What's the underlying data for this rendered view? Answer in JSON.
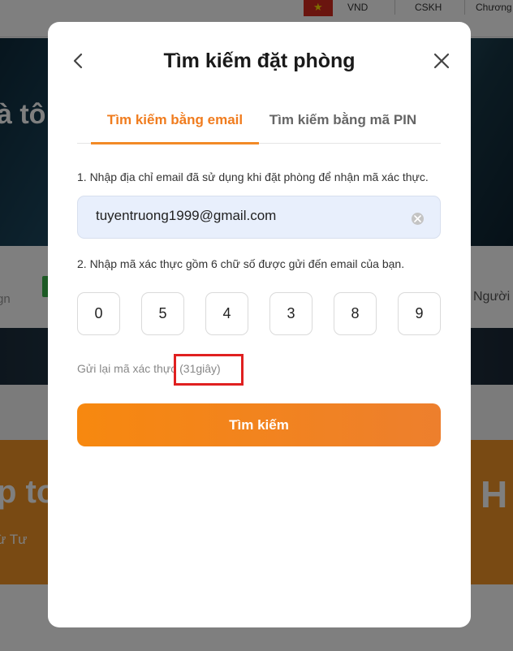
{
  "background": {
    "currency": "VND",
    "support": "CSKH",
    "promo": "Chương",
    "hero_text": "à tô",
    "left_text": "gn",
    "right_text": "Người",
    "banner_big": "p to",
    "banner_small": "ừ Tư",
    "banner_right": "H"
  },
  "modal": {
    "title": "Tìm kiếm đặt phòng",
    "tabs": [
      {
        "label": "Tìm kiếm bằng email"
      },
      {
        "label": "Tìm kiếm bằng mã PIN"
      }
    ],
    "step1_label": "1. Nhập địa chỉ email đã sử dụng khi đặt phòng để nhận mã xác thực.",
    "email_value": "tuyentruong1999@gmail.com",
    "step2_label": "2. Nhập mã xác thực gồm 6 chữ số được gửi đến email của bạn.",
    "code_digits": [
      "0",
      "5",
      "4",
      "3",
      "8",
      "9"
    ],
    "resend_label": "Gửi lại mã xác thực",
    "resend_countdown": "(31giây)",
    "search_button": "Tìm kiếm"
  },
  "colors": {
    "accent": "#f07c1e",
    "button_start": "#f7880f",
    "button_end": "#ed7f2d",
    "highlight_box": "#e02020"
  }
}
